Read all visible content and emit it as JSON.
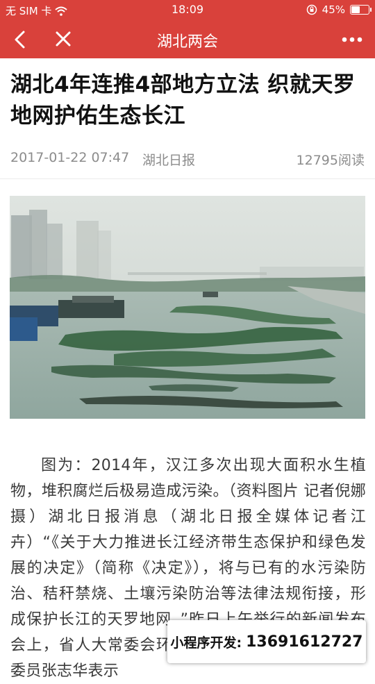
{
  "status_bar": {
    "carrier": "无 SIM 卡",
    "time": "18:09",
    "battery": "45%",
    "battery_level": 0.45
  },
  "nav": {
    "title": "湖北两会",
    "back_icon": "chevron-left-icon",
    "close_icon": "close-icon",
    "more_icon": "more-icon"
  },
  "article": {
    "title": "湖北4年连推4部地方立法 织就天罗地网护佑生态长江",
    "date": "2017-01-22 07:47",
    "source": "湖北日报",
    "reads": "12795阅读",
    "body": "图为：2014年，汉江多次出现大面积水生植物，堆积腐烂后极易造成污染。（资料图片 记者倪娜摄）湖北日报消息（湖北日报全媒体记者江卉）“《关于大力推进长江经济带生态保护和绿色发展的决定》（简称《决定》），将与已有的水污染防治、秸秆禁烧、土壤污染防治等法律法规衔接，形成保护长江的天罗地网。”昨日上午举行的新闻发布会上，省人大常委会环境与资源保护委员会副主任委员张志华表示"
  },
  "promo": {
    "label": "小程序开发:",
    "phone": "13691612727"
  },
  "colors": {
    "accent": "#d9413b",
    "meta_text": "#8c8c8c"
  }
}
